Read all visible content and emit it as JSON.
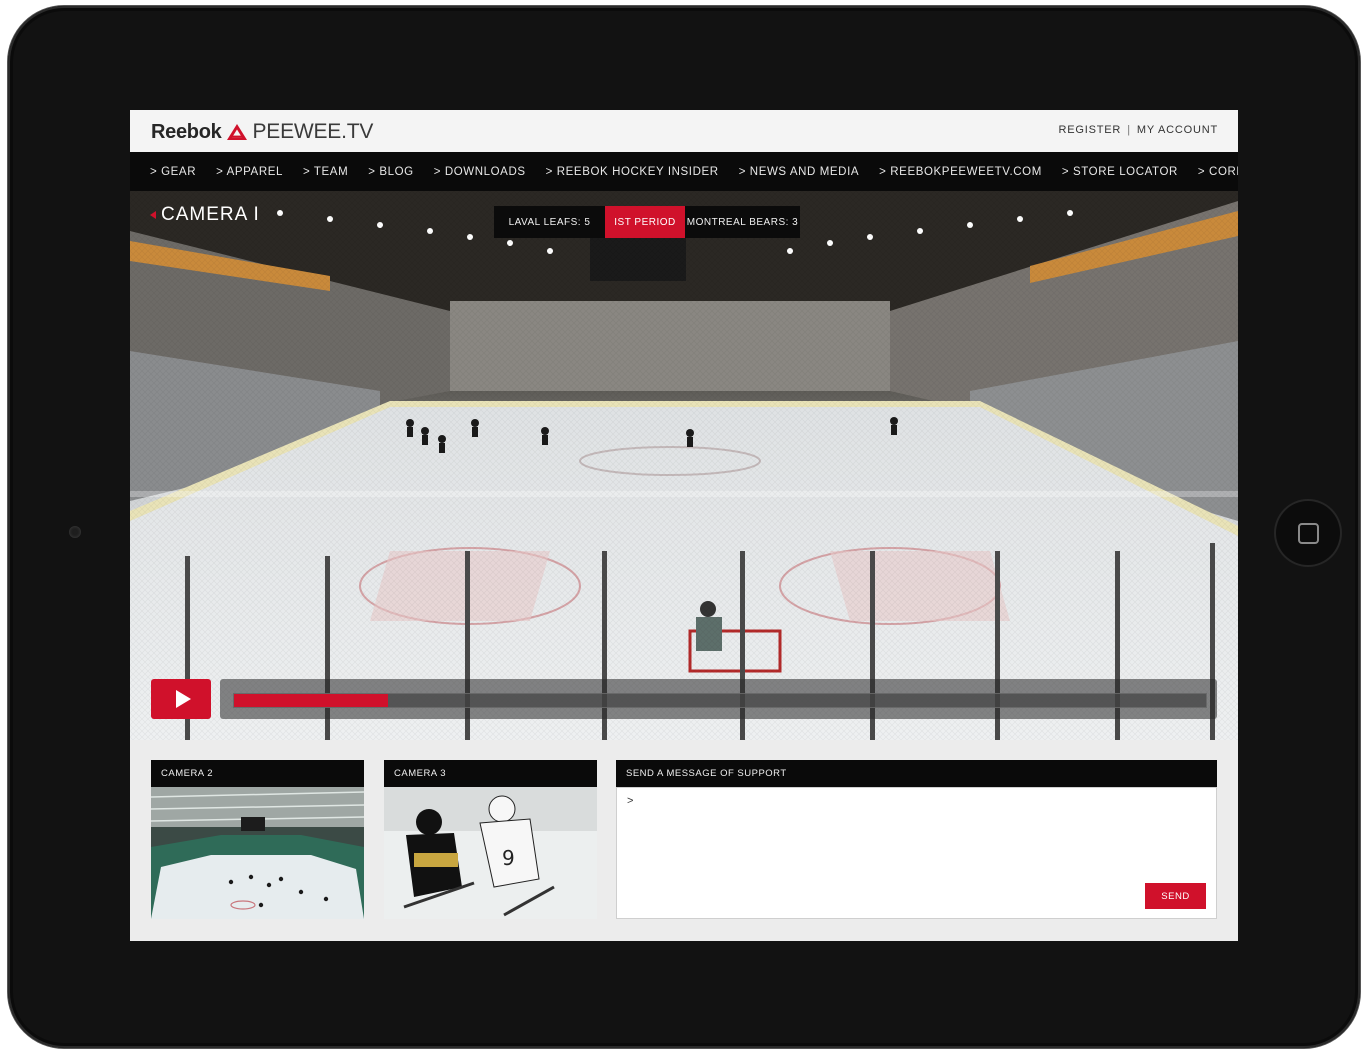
{
  "brand": {
    "name": "Reebok",
    "site": "PEEWEE.TV"
  },
  "account": {
    "register": "REGISTER",
    "separator": "|",
    "my_account": "MY ACCOUNT"
  },
  "nav": {
    "items": [
      {
        "label": "> GEAR"
      },
      {
        "label": "> APPAREL"
      },
      {
        "label": "> TEAM"
      },
      {
        "label": "> BLOG"
      },
      {
        "label": "> DOWNLOADS"
      },
      {
        "label": "> REEBOK HOCKEY INSIDER"
      },
      {
        "label": "> NEWS AND MEDIA"
      },
      {
        "label": "> REEBOKPEEWEETV.COM"
      },
      {
        "label": "> STORE LOCATOR"
      },
      {
        "label": "> CORPORATE"
      }
    ]
  },
  "player": {
    "camera_label": "CAMERA I",
    "home_team": "LAVAL LEAFS: 5",
    "period": "IST PERIOD",
    "away_team": "MONTREAL BEARS: 3",
    "progress": 0.158
  },
  "cameras": [
    {
      "label": "CAMERA 2"
    },
    {
      "label": "CAMERA 3"
    }
  ],
  "support": {
    "title": "SEND A MESSAGE OF SUPPORT",
    "prompt": ">",
    "send_label": "SEND"
  },
  "colors": {
    "accent": "#d0112b",
    "nav_bg": "#0a0a0a",
    "page_bg": "#ececec"
  }
}
